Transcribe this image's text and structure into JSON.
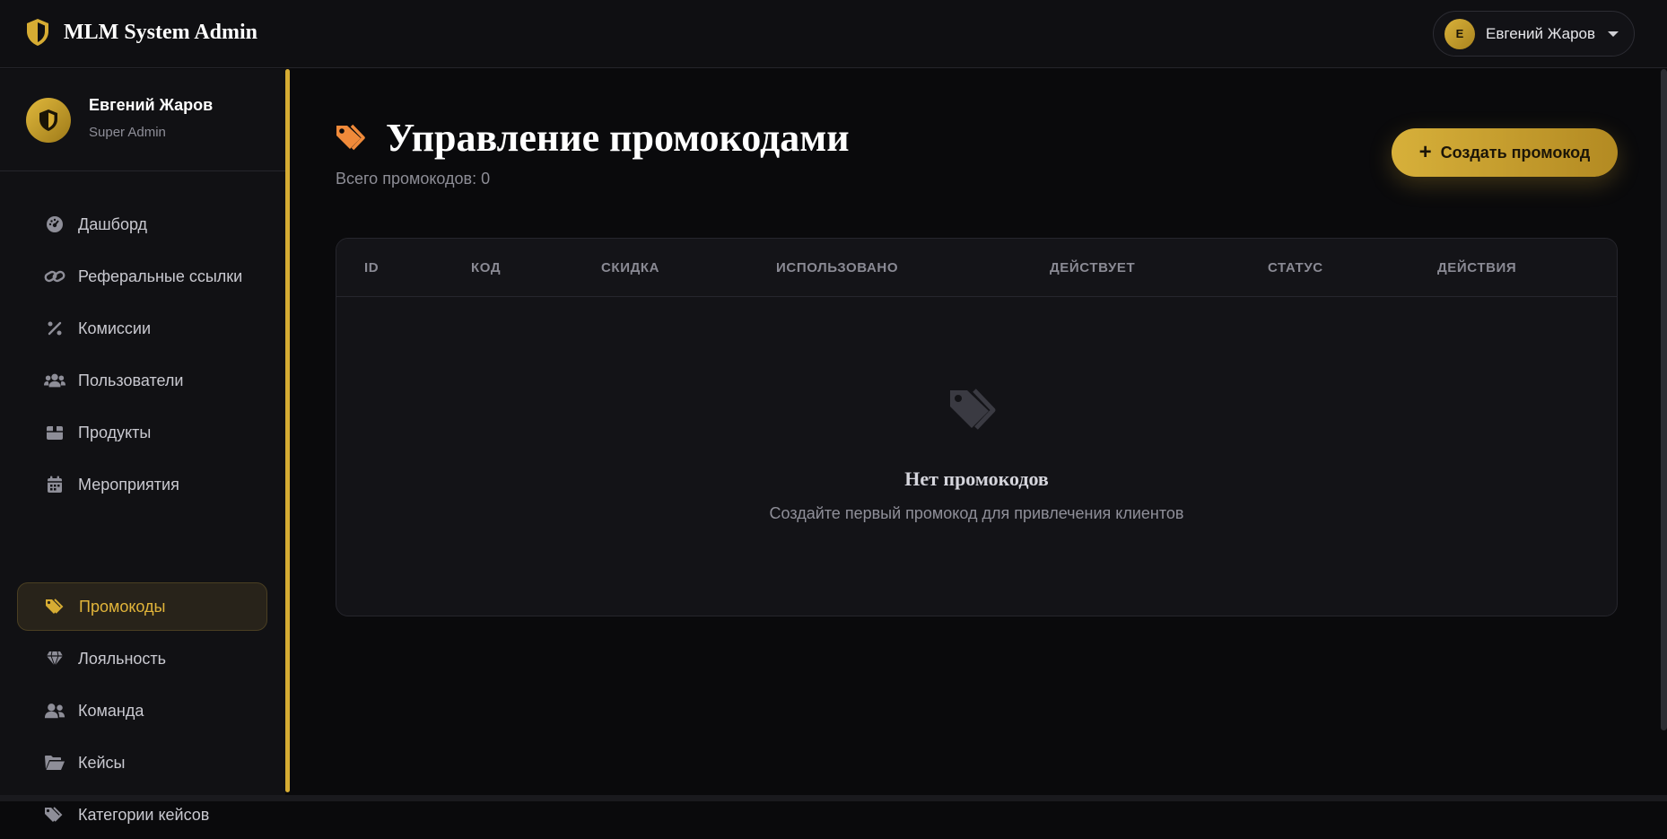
{
  "app": {
    "title": "MLM System Admin"
  },
  "user_menu": {
    "initial": "E",
    "name": "Евгений Жаров"
  },
  "profile": {
    "name": "Евгений Жаров",
    "role": "Super Admin"
  },
  "sidebar": {
    "items": [
      {
        "label": "Дашборд",
        "icon": "dashboard-icon"
      },
      {
        "label": "Реферальные ссылки",
        "icon": "link-icon"
      },
      {
        "label": "Комиссии",
        "icon": "percent-icon"
      },
      {
        "label": "Пользователи",
        "icon": "users-icon"
      },
      {
        "label": "Продукты",
        "icon": "box-icon"
      },
      {
        "label": "Мероприятия",
        "icon": "calendar-icon"
      },
      {
        "label": "Промокоды",
        "icon": "tags-icon",
        "active": true
      },
      {
        "label": "Лояльность",
        "icon": "gem-icon"
      },
      {
        "label": "Команда",
        "icon": "team-icon"
      },
      {
        "label": "Кейсы",
        "icon": "folder-icon"
      },
      {
        "label": "Категории кейсов",
        "icon": "tag-icon"
      }
    ]
  },
  "page": {
    "title": "Управление промокодами",
    "subtitle": "Всего промокодов: 0",
    "create_button": "Создать промокод"
  },
  "table": {
    "columns": [
      "ID",
      "КОД",
      "СКИДКА",
      "ИСПОЛЬЗОВАНО",
      "ДЕЙСТВУЕТ",
      "СТАТУС",
      "ДЕЙСТВИЯ"
    ],
    "empty_title": "Нет промокодов",
    "empty_text": "Создайте первый промокод для привлечения клиентов"
  },
  "colors": {
    "accent": "#d6ac33",
    "promo_icon": "#f08a3a",
    "background": "#0a0a0c"
  }
}
